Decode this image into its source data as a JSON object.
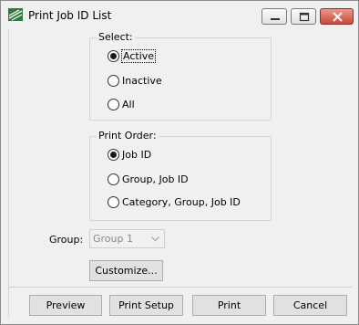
{
  "window": {
    "title": "Print Job ID List"
  },
  "icons": {
    "app": "app-logo-icon",
    "minimize": "minimize-icon",
    "maximize": "maximize-icon",
    "close": "close-icon",
    "dropdown": "chevron-down-icon"
  },
  "select_group": {
    "legend": "Select:",
    "options": [
      "Active",
      "Inactive",
      "All"
    ],
    "selected": "Active"
  },
  "print_order": {
    "legend": "Print Order:",
    "options": [
      "Job ID",
      "Group, Job ID",
      "Category, Group, Job ID"
    ],
    "selected": "Job ID"
  },
  "group_field": {
    "label": "Group:",
    "value": "Group 1",
    "enabled": false
  },
  "buttons": {
    "customize": "Customize...",
    "preview": "Preview",
    "print_setup": "Print Setup",
    "print": "Print",
    "cancel": "Cancel"
  },
  "colors": {
    "close_button": "#c9493a",
    "window_bg": "#f0f0f0"
  }
}
